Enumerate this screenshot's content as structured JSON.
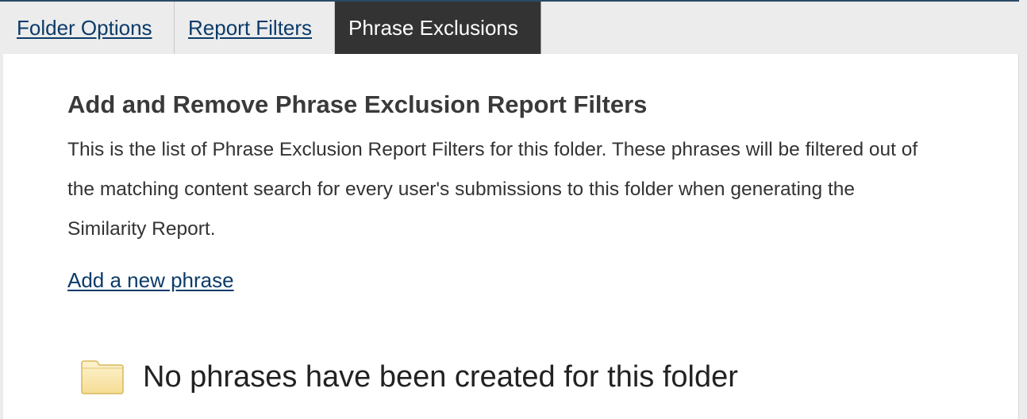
{
  "tabs": [
    {
      "label": "Folder Options",
      "active": false
    },
    {
      "label": "Report Filters",
      "active": false
    },
    {
      "label": "Phrase Exclusions",
      "active": true
    }
  ],
  "panel": {
    "heading": "Add and Remove Phrase Exclusion Report Filters",
    "description": "This is the list of Phrase Exclusion Report Filters for this folder. These phrases will be filtered out of the matching content search for every user's submissions to this folder when generating the Similarity Report.",
    "add_link_label": "Add a new phrase",
    "empty_state": {
      "icon": "folder-icon",
      "message": "No phrases have been created for this folder"
    }
  },
  "colors": {
    "link": "#0b3b6a",
    "active_tab_bg": "#333333",
    "active_tab_text": "#ffffff",
    "page_bg": "#ececec",
    "panel_bg": "#ffffff"
  }
}
